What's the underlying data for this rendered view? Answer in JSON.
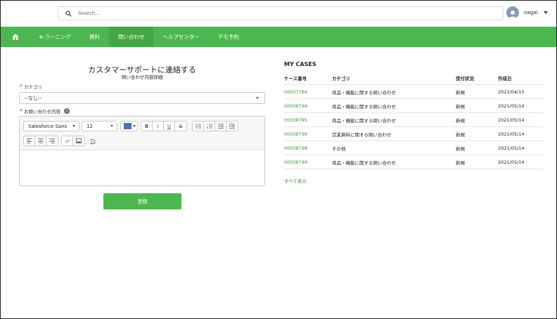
{
  "header": {
    "search_placeholder": "Search...",
    "username": "nagai"
  },
  "nav": {
    "items": [
      {
        "label": "e-ラーニング",
        "active": false
      },
      {
        "label": "資料",
        "active": false
      },
      {
        "label": "問い合わせ",
        "active": true
      },
      {
        "label": "ヘルプセンター",
        "active": false
      },
      {
        "label": "デモ予約",
        "active": false
      }
    ]
  },
  "form": {
    "title": "カスタマーサポートに連絡する",
    "subtitle": "問い合わせ内容詳細",
    "category_label": "カテゴリ",
    "category_value": "--なし--",
    "inquiry_label": "お問い合わせ内容",
    "font_family": "Salesforce Sans",
    "font_size": "12",
    "text_color": "#4a6fb5",
    "submit_label": "登録"
  },
  "cases": {
    "title": "MY CASES",
    "columns": [
      "ケース番号",
      "カテゴリ",
      "受付状況",
      "作成日"
    ],
    "rows": [
      {
        "number": "00037784",
        "category": "商品・機能に関する問い合わせ",
        "status": "新規",
        "date": "2021/04/15"
      },
      {
        "number": "00038794",
        "category": "商品・機能に関する問い合わせ",
        "status": "新規",
        "date": "2021/05/14"
      },
      {
        "number": "00038795",
        "category": "商品・機能に関する問い合わせ",
        "status": "新規",
        "date": "2021/05/14"
      },
      {
        "number": "00038796",
        "category": "営業資料に関する問い合わせ",
        "status": "新規",
        "date": "2021/05/14"
      },
      {
        "number": "00038798",
        "category": "その他",
        "status": "新規",
        "date": "2021/05/14"
      },
      {
        "number": "00038799",
        "category": "商品・機能に関する問い合わせ",
        "status": "新規",
        "date": "2021/05/14"
      }
    ],
    "see_all": "すべて表示"
  },
  "colors": {
    "brand_green": "#4db74f",
    "active_tab": "#42a744",
    "link_green": "#3a8f3c"
  }
}
